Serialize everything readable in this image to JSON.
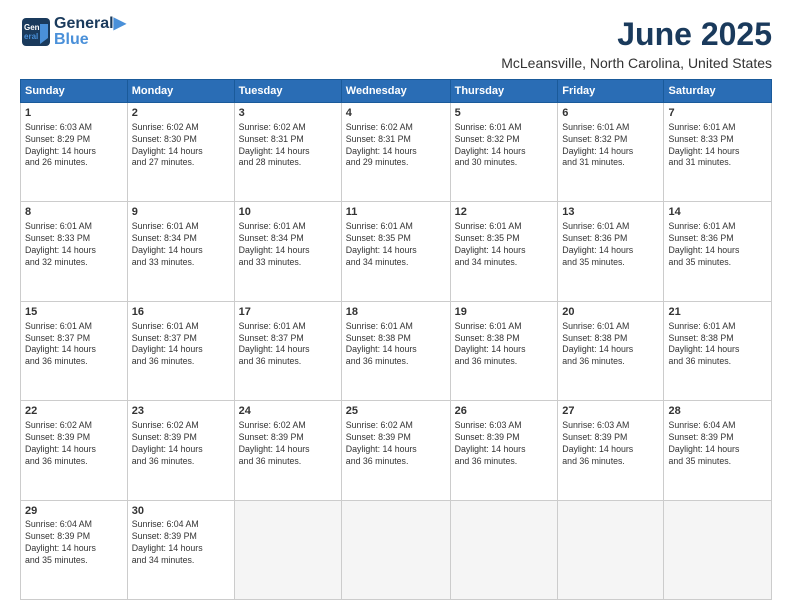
{
  "header": {
    "logo_general": "General",
    "logo_blue": "Blue",
    "main_title": "June 2025",
    "subtitle": "McLeansville, North Carolina, United States"
  },
  "days_of_week": [
    "Sunday",
    "Monday",
    "Tuesday",
    "Wednesday",
    "Thursday",
    "Friday",
    "Saturday"
  ],
  "weeks": [
    [
      {
        "day": "1",
        "info": "Sunrise: 6:03 AM\nSunset: 8:29 PM\nDaylight: 14 hours\nand 26 minutes."
      },
      {
        "day": "2",
        "info": "Sunrise: 6:02 AM\nSunset: 8:30 PM\nDaylight: 14 hours\nand 27 minutes."
      },
      {
        "day": "3",
        "info": "Sunrise: 6:02 AM\nSunset: 8:31 PM\nDaylight: 14 hours\nand 28 minutes."
      },
      {
        "day": "4",
        "info": "Sunrise: 6:02 AM\nSunset: 8:31 PM\nDaylight: 14 hours\nand 29 minutes."
      },
      {
        "day": "5",
        "info": "Sunrise: 6:01 AM\nSunset: 8:32 PM\nDaylight: 14 hours\nand 30 minutes."
      },
      {
        "day": "6",
        "info": "Sunrise: 6:01 AM\nSunset: 8:32 PM\nDaylight: 14 hours\nand 31 minutes."
      },
      {
        "day": "7",
        "info": "Sunrise: 6:01 AM\nSunset: 8:33 PM\nDaylight: 14 hours\nand 31 minutes."
      }
    ],
    [
      {
        "day": "8",
        "info": "Sunrise: 6:01 AM\nSunset: 8:33 PM\nDaylight: 14 hours\nand 32 minutes."
      },
      {
        "day": "9",
        "info": "Sunrise: 6:01 AM\nSunset: 8:34 PM\nDaylight: 14 hours\nand 33 minutes."
      },
      {
        "day": "10",
        "info": "Sunrise: 6:01 AM\nSunset: 8:34 PM\nDaylight: 14 hours\nand 33 minutes."
      },
      {
        "day": "11",
        "info": "Sunrise: 6:01 AM\nSunset: 8:35 PM\nDaylight: 14 hours\nand 34 minutes."
      },
      {
        "day": "12",
        "info": "Sunrise: 6:01 AM\nSunset: 8:35 PM\nDaylight: 14 hours\nand 34 minutes."
      },
      {
        "day": "13",
        "info": "Sunrise: 6:01 AM\nSunset: 8:36 PM\nDaylight: 14 hours\nand 35 minutes."
      },
      {
        "day": "14",
        "info": "Sunrise: 6:01 AM\nSunset: 8:36 PM\nDaylight: 14 hours\nand 35 minutes."
      }
    ],
    [
      {
        "day": "15",
        "info": "Sunrise: 6:01 AM\nSunset: 8:37 PM\nDaylight: 14 hours\nand 36 minutes."
      },
      {
        "day": "16",
        "info": "Sunrise: 6:01 AM\nSunset: 8:37 PM\nDaylight: 14 hours\nand 36 minutes."
      },
      {
        "day": "17",
        "info": "Sunrise: 6:01 AM\nSunset: 8:37 PM\nDaylight: 14 hours\nand 36 minutes."
      },
      {
        "day": "18",
        "info": "Sunrise: 6:01 AM\nSunset: 8:38 PM\nDaylight: 14 hours\nand 36 minutes."
      },
      {
        "day": "19",
        "info": "Sunrise: 6:01 AM\nSunset: 8:38 PM\nDaylight: 14 hours\nand 36 minutes."
      },
      {
        "day": "20",
        "info": "Sunrise: 6:01 AM\nSunset: 8:38 PM\nDaylight: 14 hours\nand 36 minutes."
      },
      {
        "day": "21",
        "info": "Sunrise: 6:01 AM\nSunset: 8:38 PM\nDaylight: 14 hours\nand 36 minutes."
      }
    ],
    [
      {
        "day": "22",
        "info": "Sunrise: 6:02 AM\nSunset: 8:39 PM\nDaylight: 14 hours\nand 36 minutes."
      },
      {
        "day": "23",
        "info": "Sunrise: 6:02 AM\nSunset: 8:39 PM\nDaylight: 14 hours\nand 36 minutes."
      },
      {
        "day": "24",
        "info": "Sunrise: 6:02 AM\nSunset: 8:39 PM\nDaylight: 14 hours\nand 36 minutes."
      },
      {
        "day": "25",
        "info": "Sunrise: 6:02 AM\nSunset: 8:39 PM\nDaylight: 14 hours\nand 36 minutes."
      },
      {
        "day": "26",
        "info": "Sunrise: 6:03 AM\nSunset: 8:39 PM\nDaylight: 14 hours\nand 36 minutes."
      },
      {
        "day": "27",
        "info": "Sunrise: 6:03 AM\nSunset: 8:39 PM\nDaylight: 14 hours\nand 36 minutes."
      },
      {
        "day": "28",
        "info": "Sunrise: 6:04 AM\nSunset: 8:39 PM\nDaylight: 14 hours\nand 35 minutes."
      }
    ],
    [
      {
        "day": "29",
        "info": "Sunrise: 6:04 AM\nSunset: 8:39 PM\nDaylight: 14 hours\nand 35 minutes."
      },
      {
        "day": "30",
        "info": "Sunrise: 6:04 AM\nSunset: 8:39 PM\nDaylight: 14 hours\nand 34 minutes."
      },
      {
        "day": "",
        "info": ""
      },
      {
        "day": "",
        "info": ""
      },
      {
        "day": "",
        "info": ""
      },
      {
        "day": "",
        "info": ""
      },
      {
        "day": "",
        "info": ""
      }
    ]
  ]
}
